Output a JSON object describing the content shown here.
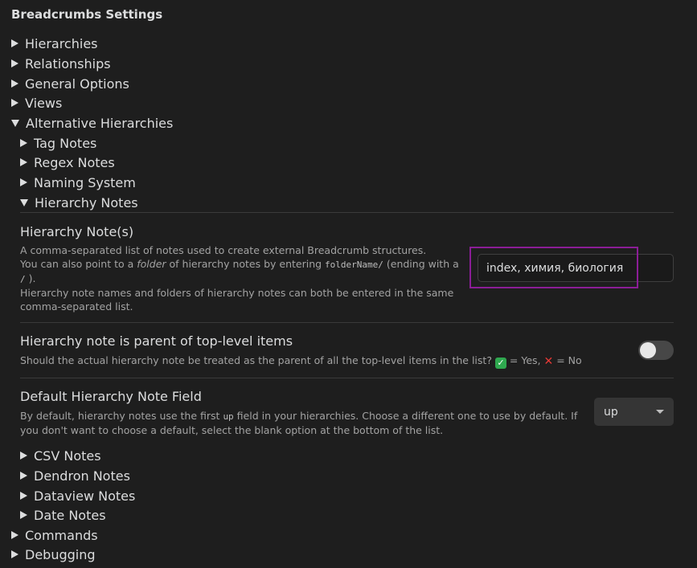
{
  "header": {
    "title": "Breadcrumbs Settings"
  },
  "top_sections": [
    "Hierarchies",
    "Relationships",
    "General Options",
    "Views",
    "Alternative Hierarchies"
  ],
  "alt_subsections": [
    "Tag Notes",
    "Regex Notes",
    "Naming System",
    "Hierarchy Notes"
  ],
  "hierarchy_notes": {
    "name": "Hierarchy Note(s)",
    "desc_line1": "A comma-separated list of notes used to create external Breadcrumb structures.",
    "desc_line2_a": "You can also point to a ",
    "desc_line2_em": "folder",
    "desc_line2_b": " of hierarchy notes by entering ",
    "desc_line2_code": "folderName/",
    "desc_line2_c": " (ending with a",
    "desc_line3_code": "/",
    "desc_line3_b": " ).",
    "desc_line4": "Hierarchy note names and folders of hierarchy notes can both be entered in the same",
    "desc_line5": "comma-separated list.",
    "value": "index, химия, биология"
  },
  "parent_toggle": {
    "name": "Hierarchy note is parent of top-level items",
    "desc_a": "Should the actual hierarchy note be treated as the parent of all the top-level items in the list?",
    "desc_yes": " = Yes,",
    "desc_no": " = No",
    "enabled": false
  },
  "default_field": {
    "name": "Default Hierarchy Note Field",
    "desc_a": "By default, hierarchy notes use the first",
    "desc_code": "up",
    "desc_b": "field in your hierarchies. Choose a different one to use by default. If",
    "desc_line2": "you don't want to choose a default, select the blank option at the bottom of the list.",
    "selected": "up"
  },
  "more_subsections": [
    "CSV Notes",
    "Dendron Notes",
    "Dataview Notes",
    "Date Notes"
  ],
  "bottom_sections": [
    "Commands",
    "Debugging"
  ],
  "colors": {
    "highlight": "#8b1d96",
    "background": "#1e1e1e"
  }
}
